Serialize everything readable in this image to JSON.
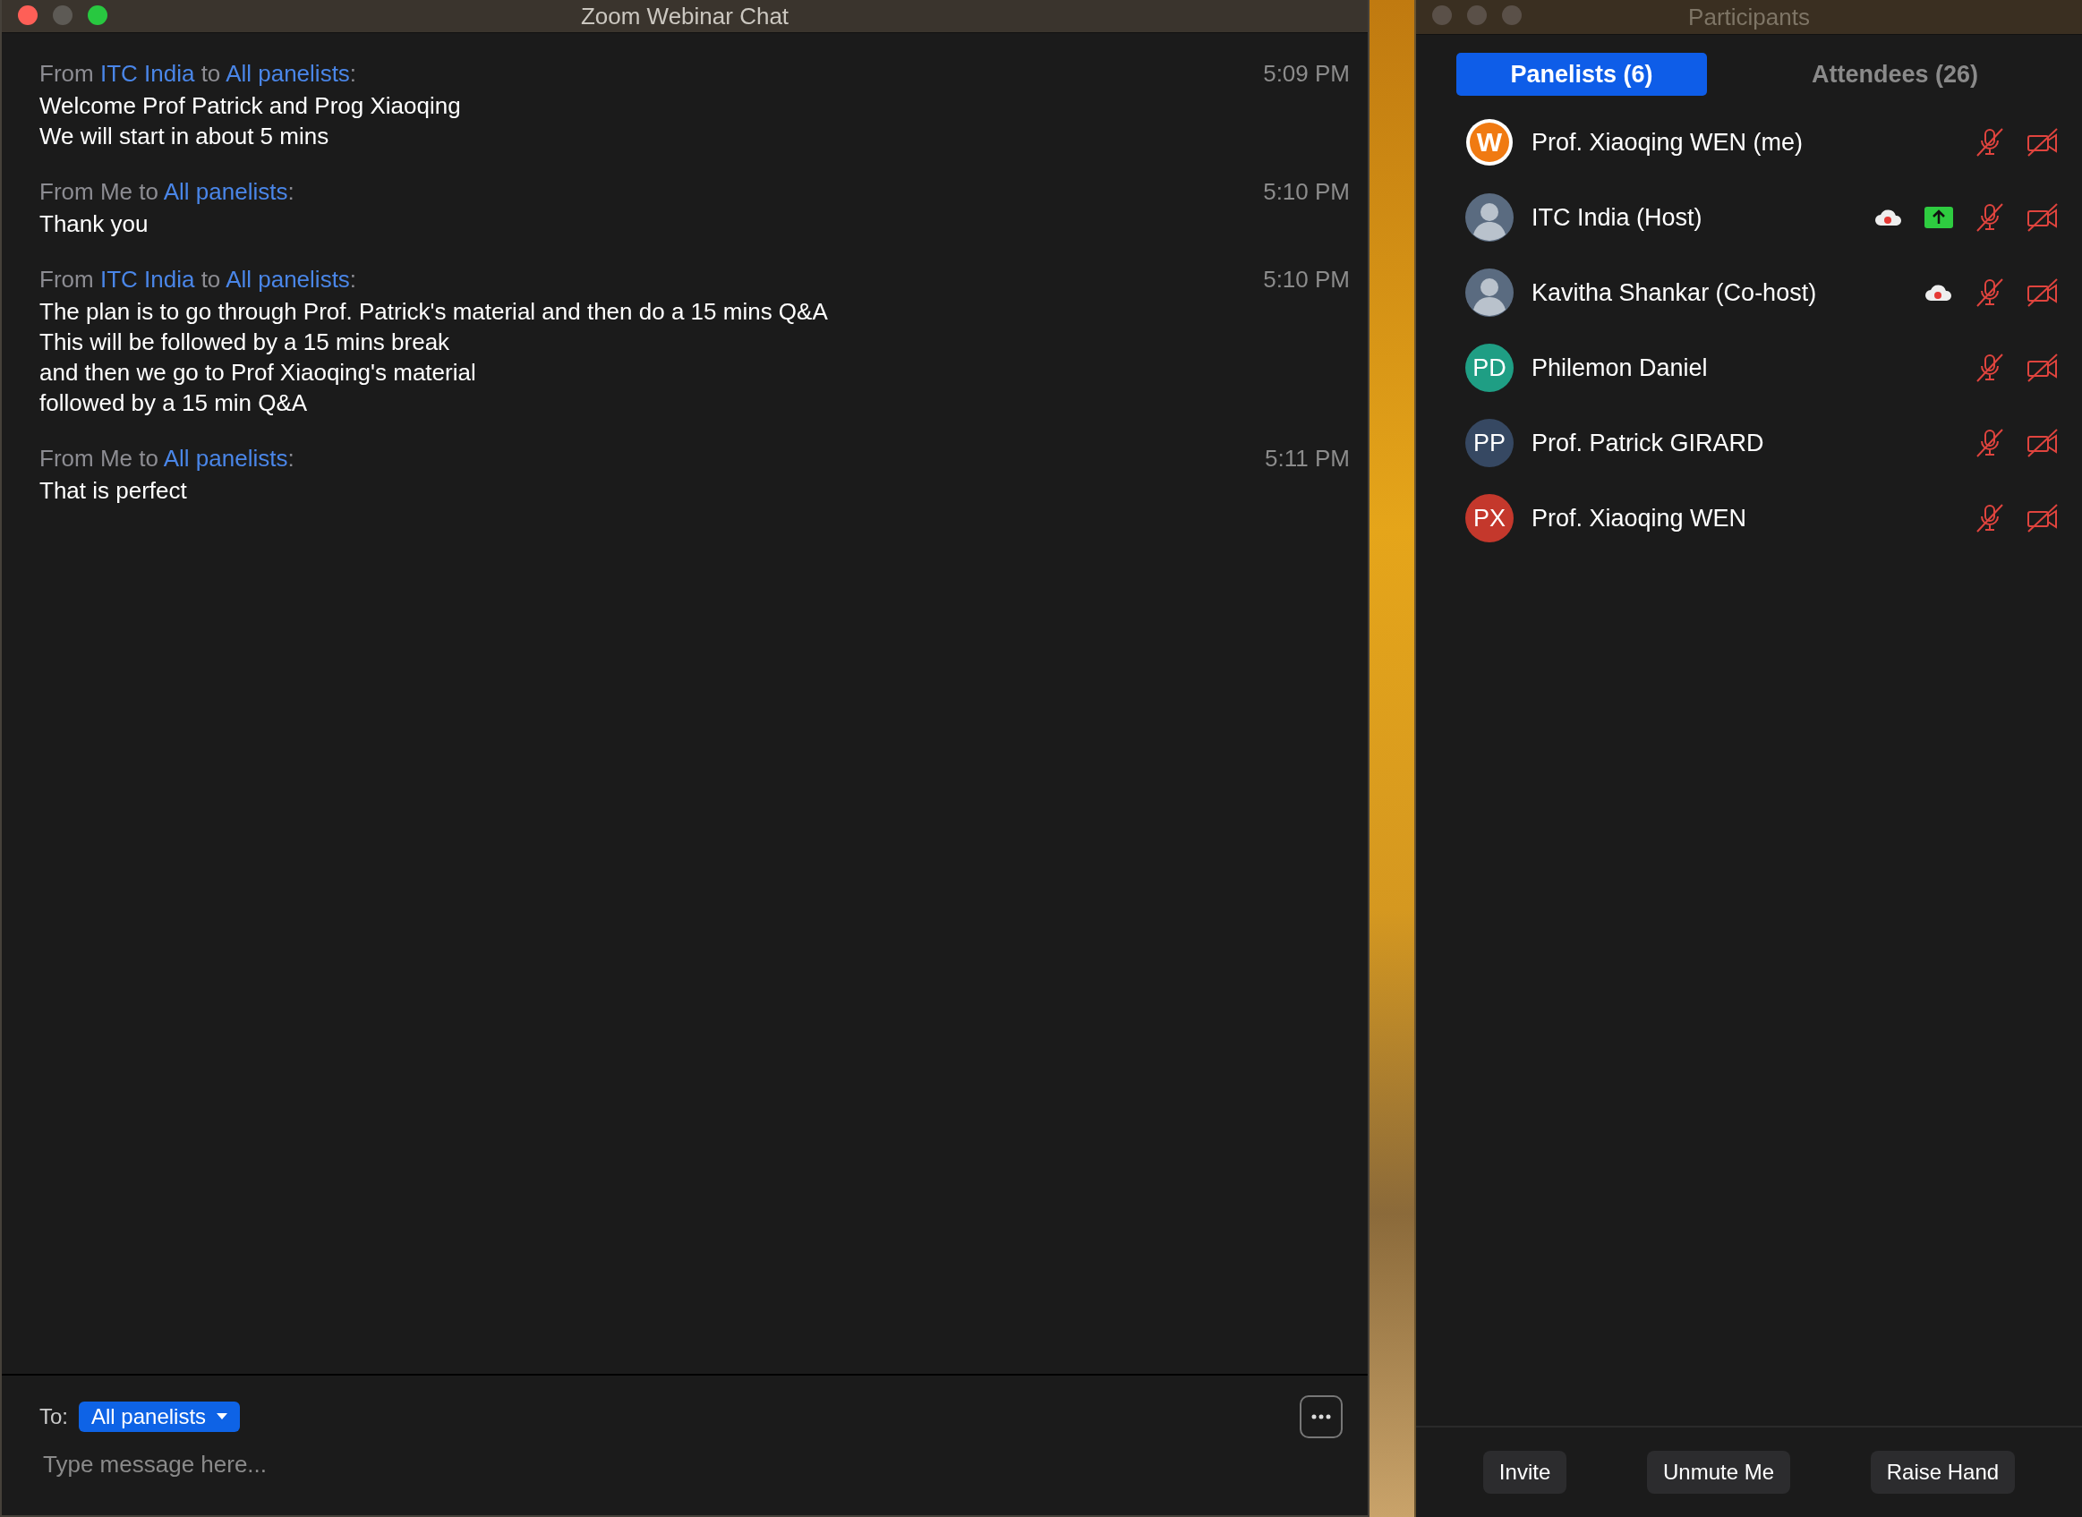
{
  "chat_window": {
    "title": "Zoom Webinar Chat",
    "messages": [
      {
        "header": [
          {
            "text": "From",
            "kind": "plain"
          },
          {
            "text": "ITC India",
            "kind": "link"
          },
          {
            "text": "to",
            "kind": "plain"
          },
          {
            "text": "All panelists",
            "kind": "link"
          },
          {
            "text": ":",
            "kind": "tail"
          }
        ],
        "time": "5:09 PM",
        "lines": [
          "Welcome Prof Patrick and Prog Xiaoqing",
          "We will start in about 5 mins"
        ]
      },
      {
        "header": [
          {
            "text": "From",
            "kind": "plain"
          },
          {
            "text": "Me",
            "kind": "plain"
          },
          {
            "text": "to",
            "kind": "plain"
          },
          {
            "text": "All panelists",
            "kind": "link"
          },
          {
            "text": ":",
            "kind": "tail"
          }
        ],
        "time": "5:10 PM",
        "lines": [
          "Thank you"
        ]
      },
      {
        "header": [
          {
            "text": "From",
            "kind": "plain"
          },
          {
            "text": "ITC India",
            "kind": "link"
          },
          {
            "text": "to",
            "kind": "plain"
          },
          {
            "text": "All panelists",
            "kind": "link"
          },
          {
            "text": ":",
            "kind": "tail"
          }
        ],
        "time": "5:10 PM",
        "lines": [
          "The plan is to go through Prof. Patrick's material and then do a 15 mins Q&A",
          "This will be followed by a 15 mins break",
          "and then we go to Prof Xiaoqing's material",
          "followed by a 15 min Q&A"
        ]
      },
      {
        "header": [
          {
            "text": "From",
            "kind": "plain"
          },
          {
            "text": "Me",
            "kind": "plain"
          },
          {
            "text": "to",
            "kind": "plain"
          },
          {
            "text": "All panelists",
            "kind": "link"
          },
          {
            "text": ":",
            "kind": "tail"
          }
        ],
        "time": "5:11 PM",
        "lines": [
          "That is perfect"
        ]
      }
    ],
    "composer": {
      "to_label": "To:",
      "recipient": "All panelists",
      "placeholder": "Type message here..."
    }
  },
  "participants_window": {
    "title": "Participants",
    "tabs": [
      {
        "label": "Panelists (6)",
        "selected": true
      },
      {
        "label": "Attendees (26)",
        "selected": false
      }
    ],
    "panelists": [
      {
        "name": "Prof. Xiaoqing WEN (me)",
        "avatar": {
          "kind": "logo",
          "text": "W"
        },
        "recording": false,
        "sharing": false,
        "audio_muted": true,
        "video_off": true
      },
      {
        "name": "ITC India (Host)",
        "avatar": {
          "kind": "photo"
        },
        "recording": true,
        "sharing": true,
        "audio_muted": true,
        "video_off": true
      },
      {
        "name": "Kavitha Shankar (Co-host)",
        "avatar": {
          "kind": "photo"
        },
        "recording": true,
        "sharing": false,
        "audio_muted": true,
        "video_off": true
      },
      {
        "name": "Philemon Daniel",
        "avatar": {
          "kind": "initials",
          "text": "PD",
          "color": "#1f9e84"
        },
        "recording": false,
        "sharing": false,
        "audio_muted": true,
        "video_off": true
      },
      {
        "name": "Prof. Patrick GIRARD",
        "avatar": {
          "kind": "initials",
          "text": "PP",
          "color": "#364862"
        },
        "recording": false,
        "sharing": false,
        "audio_muted": true,
        "video_off": true
      },
      {
        "name": "Prof. Xiaoqing WEN",
        "avatar": {
          "kind": "initials",
          "text": "PX",
          "color": "#c4382c"
        },
        "recording": false,
        "sharing": false,
        "audio_muted": true,
        "video_off": true
      }
    ],
    "buttons": [
      "Invite",
      "Unmute Me",
      "Raise Hand"
    ]
  }
}
